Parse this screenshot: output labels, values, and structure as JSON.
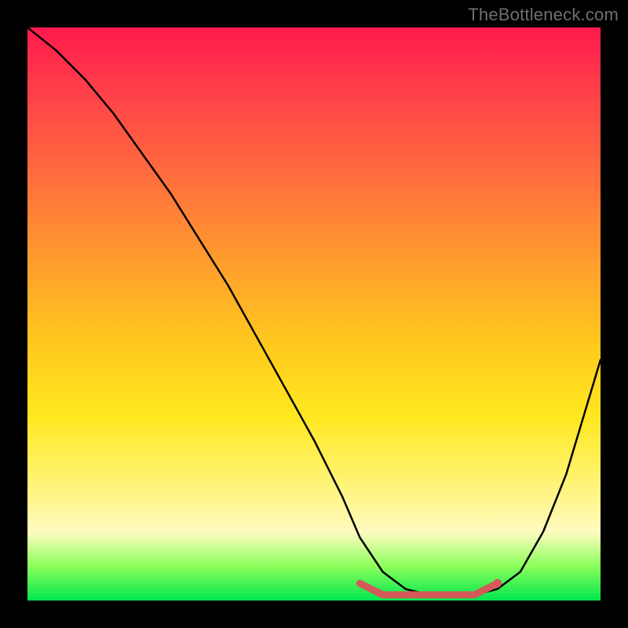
{
  "watermark": "TheBottleneck.com",
  "colors": {
    "background": "#000000",
    "gradient_top": "#ff1a4d",
    "gradient_mid1": "#ff9a2e",
    "gradient_mid2": "#ffe820",
    "gradient_bottom": "#00e64d",
    "curve": "#000000",
    "highlight": "#d45a5a"
  },
  "chart_data": {
    "type": "line",
    "title": "",
    "xlabel": "",
    "ylabel": "",
    "xlim": [
      0,
      100
    ],
    "ylim": [
      0,
      100
    ],
    "grid": false,
    "legend": false,
    "series": [
      {
        "name": "bottleneck-curve",
        "x": [
          0,
          5,
          10,
          15,
          20,
          25,
          30,
          35,
          40,
          45,
          50,
          55,
          58,
          62,
          66,
          70,
          74,
          78,
          82,
          86,
          90,
          94,
          100
        ],
        "values": [
          100,
          96,
          91,
          85,
          78,
          71,
          63,
          55,
          46,
          37,
          28,
          18,
          11,
          5,
          2,
          1,
          1,
          1,
          2,
          5,
          12,
          22,
          42
        ]
      },
      {
        "name": "highlight-band",
        "x": [
          58,
          62,
          66,
          70,
          74,
          78,
          82
        ],
        "values": [
          3,
          1,
          1,
          1,
          1,
          1,
          3
        ]
      }
    ],
    "annotations": []
  }
}
